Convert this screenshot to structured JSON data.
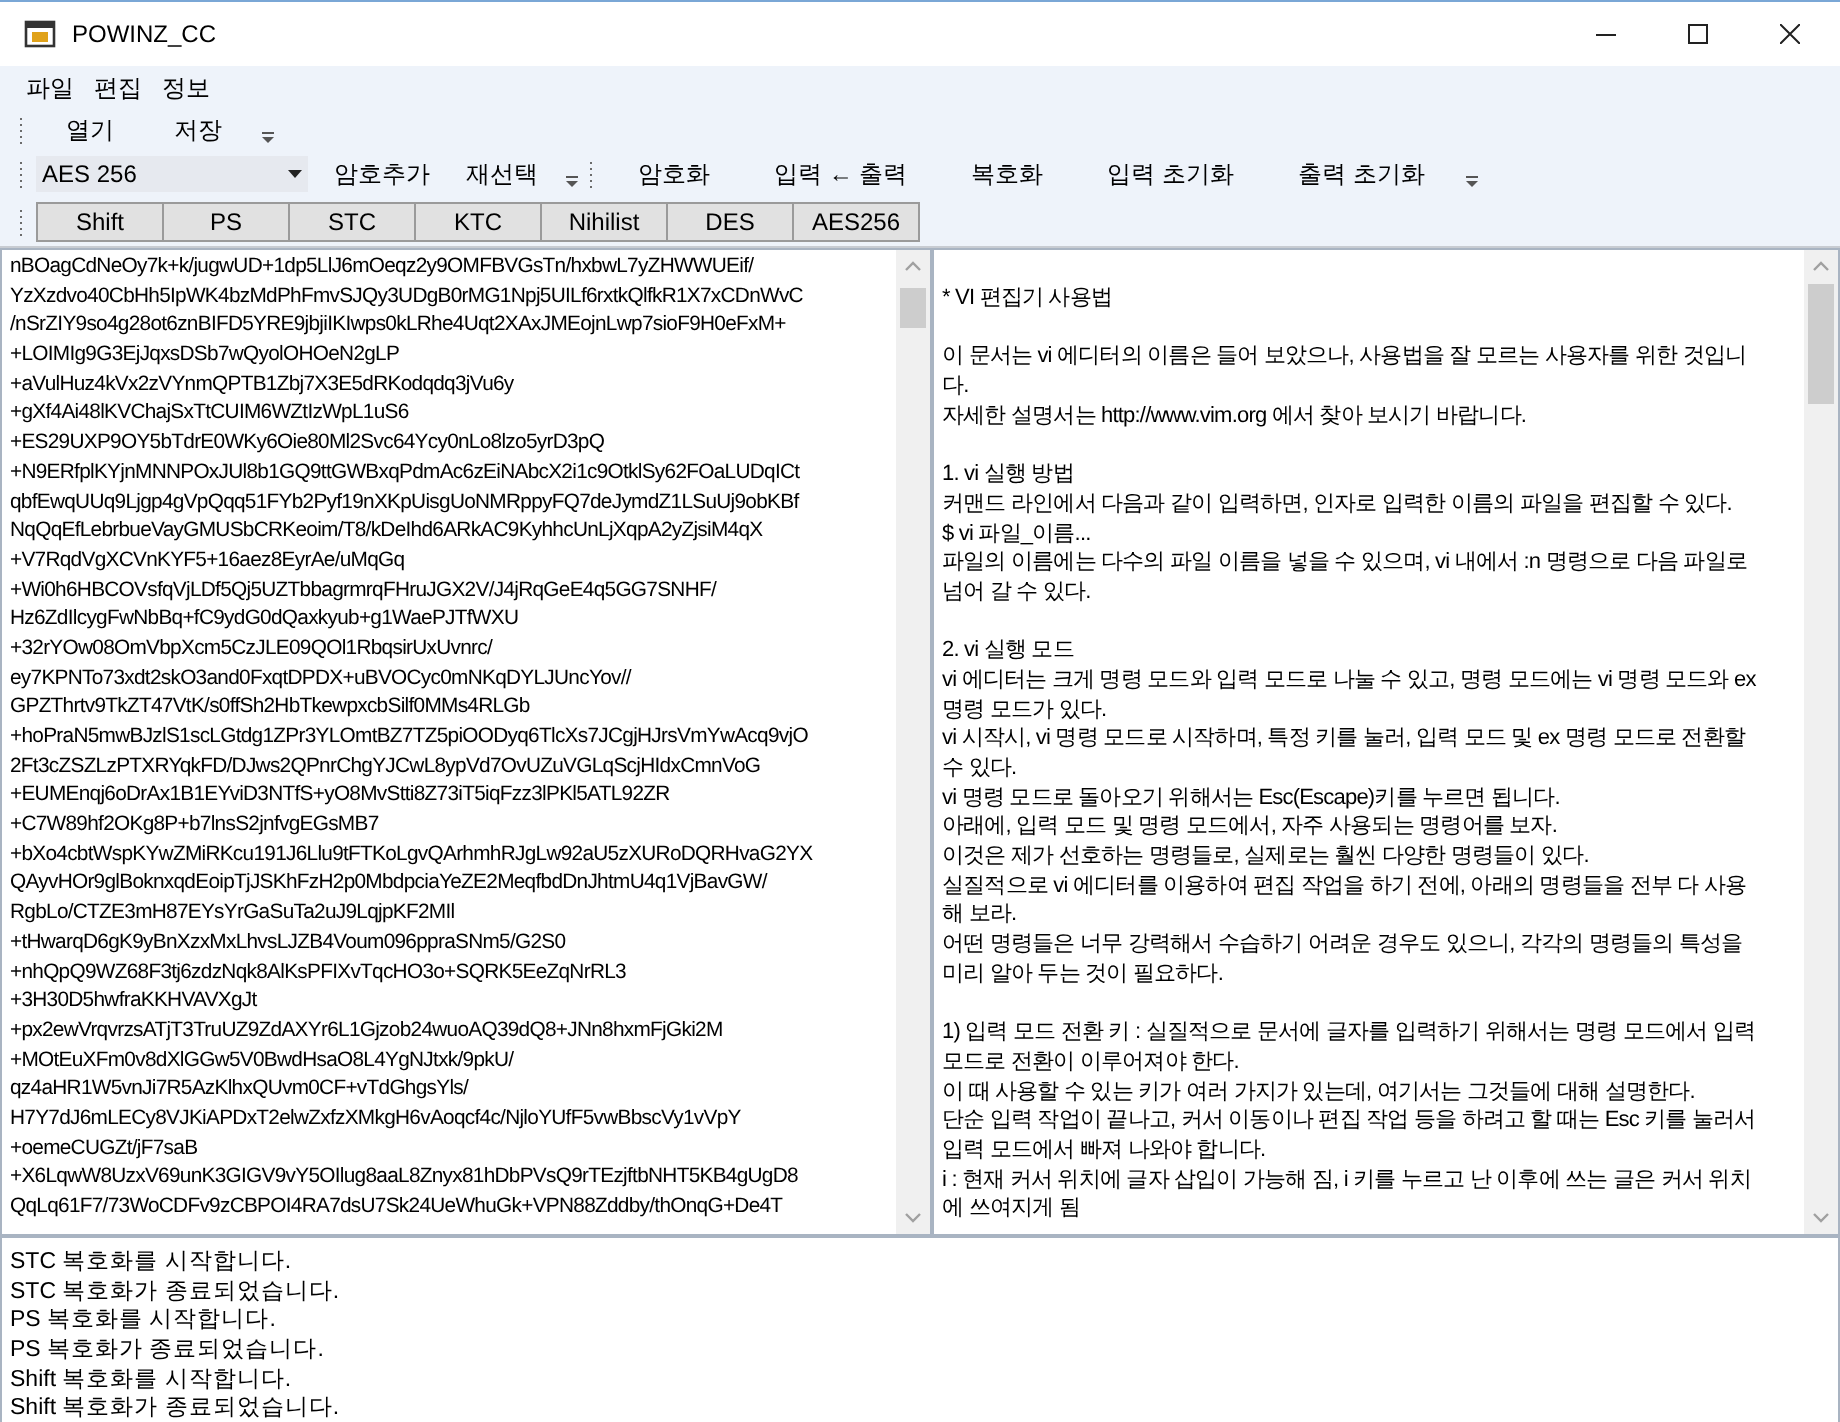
{
  "window": {
    "title": "POWINZ_CC"
  },
  "menu": [
    "파일",
    "편집",
    "정보"
  ],
  "file_toolbar": [
    "열기",
    "저장"
  ],
  "cipher_toolbar": {
    "combo_value": "AES 256",
    "buttons": [
      "암호추가",
      "재선택"
    ]
  },
  "action_toolbar": [
    "암호화",
    "입력 ← 출력",
    "복호화",
    "입력 초기화",
    "출력 초기화"
  ],
  "cipher_buttons": [
    "Shift",
    "PS",
    "STC",
    "KTC",
    "Nihilist",
    "DES",
    "AES256"
  ],
  "input_pane": {
    "lines": [
      "nBOagCdNeOy7k+k/jugwUD+1dp5LlJ6mOeqz2y9OMFBVGsTn/hxbwL7yZHWWUEif/",
      "YzXzdvo40CbHh5IpWK4bzMdPhFmvSJQy3UDgB0rMG1Npj5UILf6rxtkQlfkR1X7xCDnWvC",
      "/nSrZIY9so4g28ot6znBIFD5YRE9jbjiIKIwps0kLRhe4Uqt2XAxJMEojnLwp7sioF9H0eFxM+",
      "+LOIMIg9G3EjJqxsDSb7wQyolOHOeN2gLP",
      "+aVulHuz4kVx2zVYnmQPTB1Zbj7X3E5dRKodqdq3jVu6y",
      "+gXf4Ai48lKVChajSxTtCUIM6WZtIzWpL1uS6",
      "+ES29UXP9OY5bTdrE0WKy6Oie80Ml2Svc64Ycy0nLo8lzo5yrD3pQ",
      "+N9ERfplKYjnMNNPOxJUl8b1GQ9ttGWBxqPdmAc6zEiNAbcX2i1c9OtklSy62FOaLUDqICt",
      "qbfEwqUUq9Ljgp4gVpQqq51FYb2Pyf19nXKpUisgUoNMRppyFQ7deJymdZ1LSuUj9obKBf",
      "NqQqEfLebrbueVayGMUSbCRKeoim/T8/kDeIhd6ARkAC9KyhhcUnLjXqpA2yZjsiM4qX",
      "+V7RqdVgXCVnKYF5+16aez8EyrAe/uMqGq",
      "+Wi0h6HBCOVsfqVjLDf5Qj5UZTbbagrmrqFHruJGX2V/J4jRqGeE4q5GG7SNHF/",
      "Hz6ZdIlcygFwNbBq+fC9ydG0dQaxkyub+g1WaePJTfWXU",
      "+32rYOw08OmVbpXcm5CzJLE09QOl1RbqsirUxUvnrc/",
      "ey7KPNTo73xdt2skO3and0FxqtDPDX+uBVOCyc0mNKqDYLJUncYov//",
      "GPZThrtv9TkZT47VtK/s0ffSh2HbTkewpxcbSilf0MMs4RLGb",
      "+hoPraN5mwBJzlS1scLGtdg1ZPr3YLOmtBZ7TZ5piOODyq6TlcXs7JCgjHJrsVmYwAcq9vjO",
      "2Ft3cZSZLzPTXRYqkFD/DJws2QPnrChgYJCwL8ypVd7OvUZuVGLqScjHIdxCmnVoG",
      "+EUMEnqj6oDrAx1B1EYviD3NTfS+yO8MvStti8Z73iT5iqFzz3lPKl5ATL92ZR",
      "+C7W89hf2OKg8P+b7lnsS2jnfvgEGsMB7",
      "+bXo4cbtWspKYwZMiRKcu191J6Llu9tFTKoLgvQArhmhRJgLw92aU5zXURoDQRHvaG2YX",
      "QAyvHOr9glBoknxqdEoipTjJSKhFzH2p0MbdpciaYeZE2MeqfbdDnJhtmU4q1VjBavGW/",
      "RgbLo/CTZE3mH87EYsYrGaSuTa2uJ9LqjpKF2MIl",
      "+tHwarqD6gK9yBnXzxMxLhvsLJZB4Voum096ppraSNm5/G2S0",
      "+nhQpQ9WZ68F3tj6zdzNqk8AlKsPFIXvTqcHO3o+SQRK5EeZqNrRL3",
      "+3H30D5hwfraKKHVAVXgJt",
      "+px2ewVrqvrzsATjT3TruUZ9ZdAXYr6L1Gjzob24wuoAQ39dQ8+JNn8hxmFjGki2M",
      "+MOtEuXFm0v8dXlGGw5V0BwdHsaO8L4YgNJtxk/9pkU/",
      "qz4aHR1W5vnJi7R5AzKlhxQUvm0CF+vTdGhgsYls/",
      "H7Y7dJ6mLECy8VJKiAPDxT2elwZxfzXMkgH6vAoqcf4c/NjloYUfF5vwBbscVy1vVpY",
      "+oemeCUGZt/jF7saB",
      "+X6LqwW8UzxV69unK3GIGV9vY5OIlug8aaL8Znyx81hDbPVsQ9rTEzjftbNHT5KB4gUgD8",
      "QqLq61F7/73WoCDFv9zCBPOI4RA7dsU7Sk24UeWhuGk+VPN88Zddby/thOnqG+De4T"
    ]
  },
  "output_pane": {
    "blocks": [
      [
        "* VI 편집기 사용법"
      ],
      [
        "이 문서는 vi 에디터의 이름은 들어 보았으나, 사용법을 잘 모르는 사용자를 위한 것입니",
        "다.",
        "자세한 설명서는 http://www.vim.org 에서 찾아 보시기 바랍니다."
      ],
      [
        "1. vi 실행 방법",
        "커맨드 라인에서 다음과 같이 입력하면, 인자로 입력한 이름의 파일을 편집할 수 있다.",
        "$ vi 파일_이름...",
        "파일의 이름에는 다수의 파일 이름을 넣을 수 있으며, vi 내에서 :n 명령으로 다음 파일로",
        "넘어 갈 수 있다."
      ],
      [
        "2. vi 실행 모드",
        "vi 에디터는 크게 명령 모드와 입력 모드로 나눌 수 있고, 명령 모드에는 vi 명령 모드와 ex",
        "명령 모드가 있다.",
        "vi 시작시, vi 명령 모드로 시작하며, 특정 키를 눌러, 입력 모드 및 ex 명령 모드로 전환할",
        "수 있다.",
        "vi 명령 모드로 돌아오기 위해서는 Esc(Escape)키를 누르면 됩니다.",
        "아래에, 입력 모드 및 명령 모드에서, 자주 사용되는 명령어를 보자.",
        "이것은 제가 선호하는 명령들로, 실제로는 훨씬 다양한 명령들이 있다.",
        "실질적으로 vi 에디터를 이용하여 편집 작업을 하기 전에, 아래의 명령들을 전부 다 사용",
        "해 보라.",
        "어떤 명령들은 너무 강력해서 수습하기 어려운 경우도 있으니, 각각의 명령들의 특성을",
        "미리 알아 두는 것이 필요하다."
      ],
      [
        "1) 입력 모드 전환 키 : 실질적으로 문서에 글자를 입력하기 위해서는 명령 모드에서 입력",
        "모드로 전환이 이루어져야 한다.",
        "이 때 사용할 수 있는 키가 여러 가지가 있는데, 여기서는 그것들에 대해 설명한다.",
        "단순 입력 작업이 끝나고, 커서 이동이나 편집 작업 등을 하려고 할 때는 Esc 키를 눌러서",
        "입력 모드에서 빠져 나와야 합니다.",
        "i : 현재 커서 위치에 글자 삽입이 가능해 짐, i 키를 누르고 난 이후에 쓰는 글은 커서 위치",
        "에 쓰여지게 됨"
      ]
    ]
  },
  "log": {
    "lines": [
      "STC 복호화를 시작합니다.",
      "STC 복호화가 종료되었습니다.",
      "PS 복호화를 시작합니다.",
      "PS 복호화가 종료되었습니다.",
      "Shift 복호화를 시작합니다.",
      "Shift 복호화가 종료되었습니다."
    ]
  }
}
